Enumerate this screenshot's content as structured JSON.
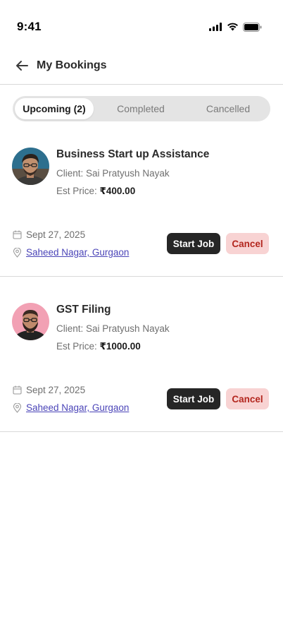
{
  "status_bar": {
    "time": "9:41"
  },
  "header": {
    "title": "My Bookings"
  },
  "tabs": [
    {
      "label": "Upcoming (2)",
      "active": true
    },
    {
      "label": "Completed",
      "active": false
    },
    {
      "label": "Cancelled",
      "active": false
    }
  ],
  "bookings": [
    {
      "service": "Business Start up Assistance",
      "client_label": "Client: ",
      "client_name": "Sai Pratyush Nayak",
      "price_label": "Est Price: ",
      "price": "₹400.00",
      "date": "Sept 27, 2025",
      "location": "Saheed Nagar, Gurgaon",
      "start_label": "Start Job",
      "cancel_label": "Cancel"
    },
    {
      "service": "GST Filing",
      "client_label": "Client: ",
      "client_name": "Sai Pratyush Nayak",
      "price_label": "Est Price: ",
      "price": "₹1000.00",
      "date": "Sept 27, 2025",
      "location": "Saheed Nagar, Gurgaon",
      "start_label": "Start Job",
      "cancel_label": "Cancel"
    }
  ],
  "colors": {
    "start_button": "#262626",
    "cancel_button_bg": "#f8d3d3",
    "cancel_button_text": "#b3261e",
    "link": "#4b45b8",
    "tab_track": "#e4e4e4"
  }
}
